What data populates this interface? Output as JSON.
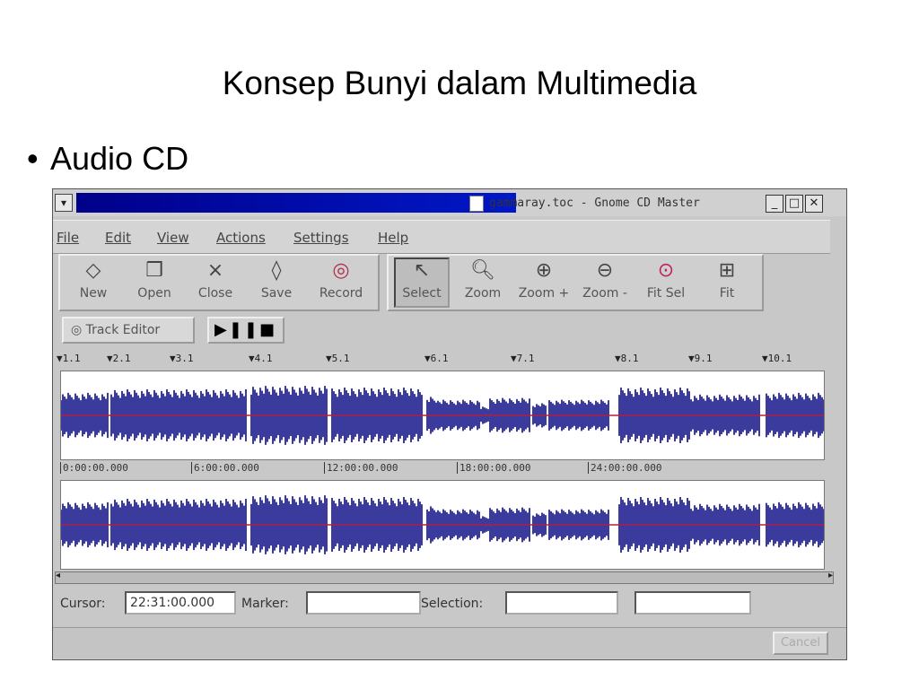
{
  "slide": {
    "title": "Konsep Bunyi dalam Multimedia",
    "bullet": "Audio CD"
  },
  "window": {
    "title": "gammaray.toc - Gnome CD Master",
    "menu": [
      "File",
      "Edit",
      "View",
      "Actions",
      "Settings",
      "Help"
    ],
    "toolbar_left": [
      {
        "label": "New",
        "icon": "new-icon"
      },
      {
        "label": "Open",
        "icon": "open-icon"
      },
      {
        "label": "Close",
        "icon": "close-icon"
      },
      {
        "label": "Save",
        "icon": "save-icon"
      },
      {
        "label": "Record",
        "icon": "record-icon"
      }
    ],
    "toolbar_right": [
      {
        "label": "Select",
        "icon": "pointer-icon",
        "selected": true
      },
      {
        "label": "Zoom",
        "icon": "zoom-icon"
      },
      {
        "label": "Zoom +",
        "icon": "zoom-in-icon"
      },
      {
        "label": "Zoom -",
        "icon": "zoom-out-icon"
      },
      {
        "label": "Fit Sel",
        "icon": "fit-selection-icon"
      },
      {
        "label": "Fit",
        "icon": "fit-icon"
      }
    ],
    "track_editor": "Track Editor",
    "markers": [
      "1.1",
      "2.1",
      "3.1",
      "4.1",
      "5.1",
      "6.1",
      "7.1",
      "8.1",
      "9.1",
      "10.1"
    ],
    "timeline": [
      "0:00:00.000",
      "6:00:00.000",
      "12:00:00.000",
      "18:00:00.000",
      "24:00:00.000"
    ],
    "status": {
      "cursor_label": "Cursor:",
      "cursor_value": "22:31:00.000",
      "marker_label": "Marker:",
      "selection_label": "Selection:"
    },
    "cancel": "Cancel",
    "colors": {
      "waveform": "#3b3b9e",
      "centerline": "#b02040",
      "titlebar": "#00008a"
    }
  }
}
